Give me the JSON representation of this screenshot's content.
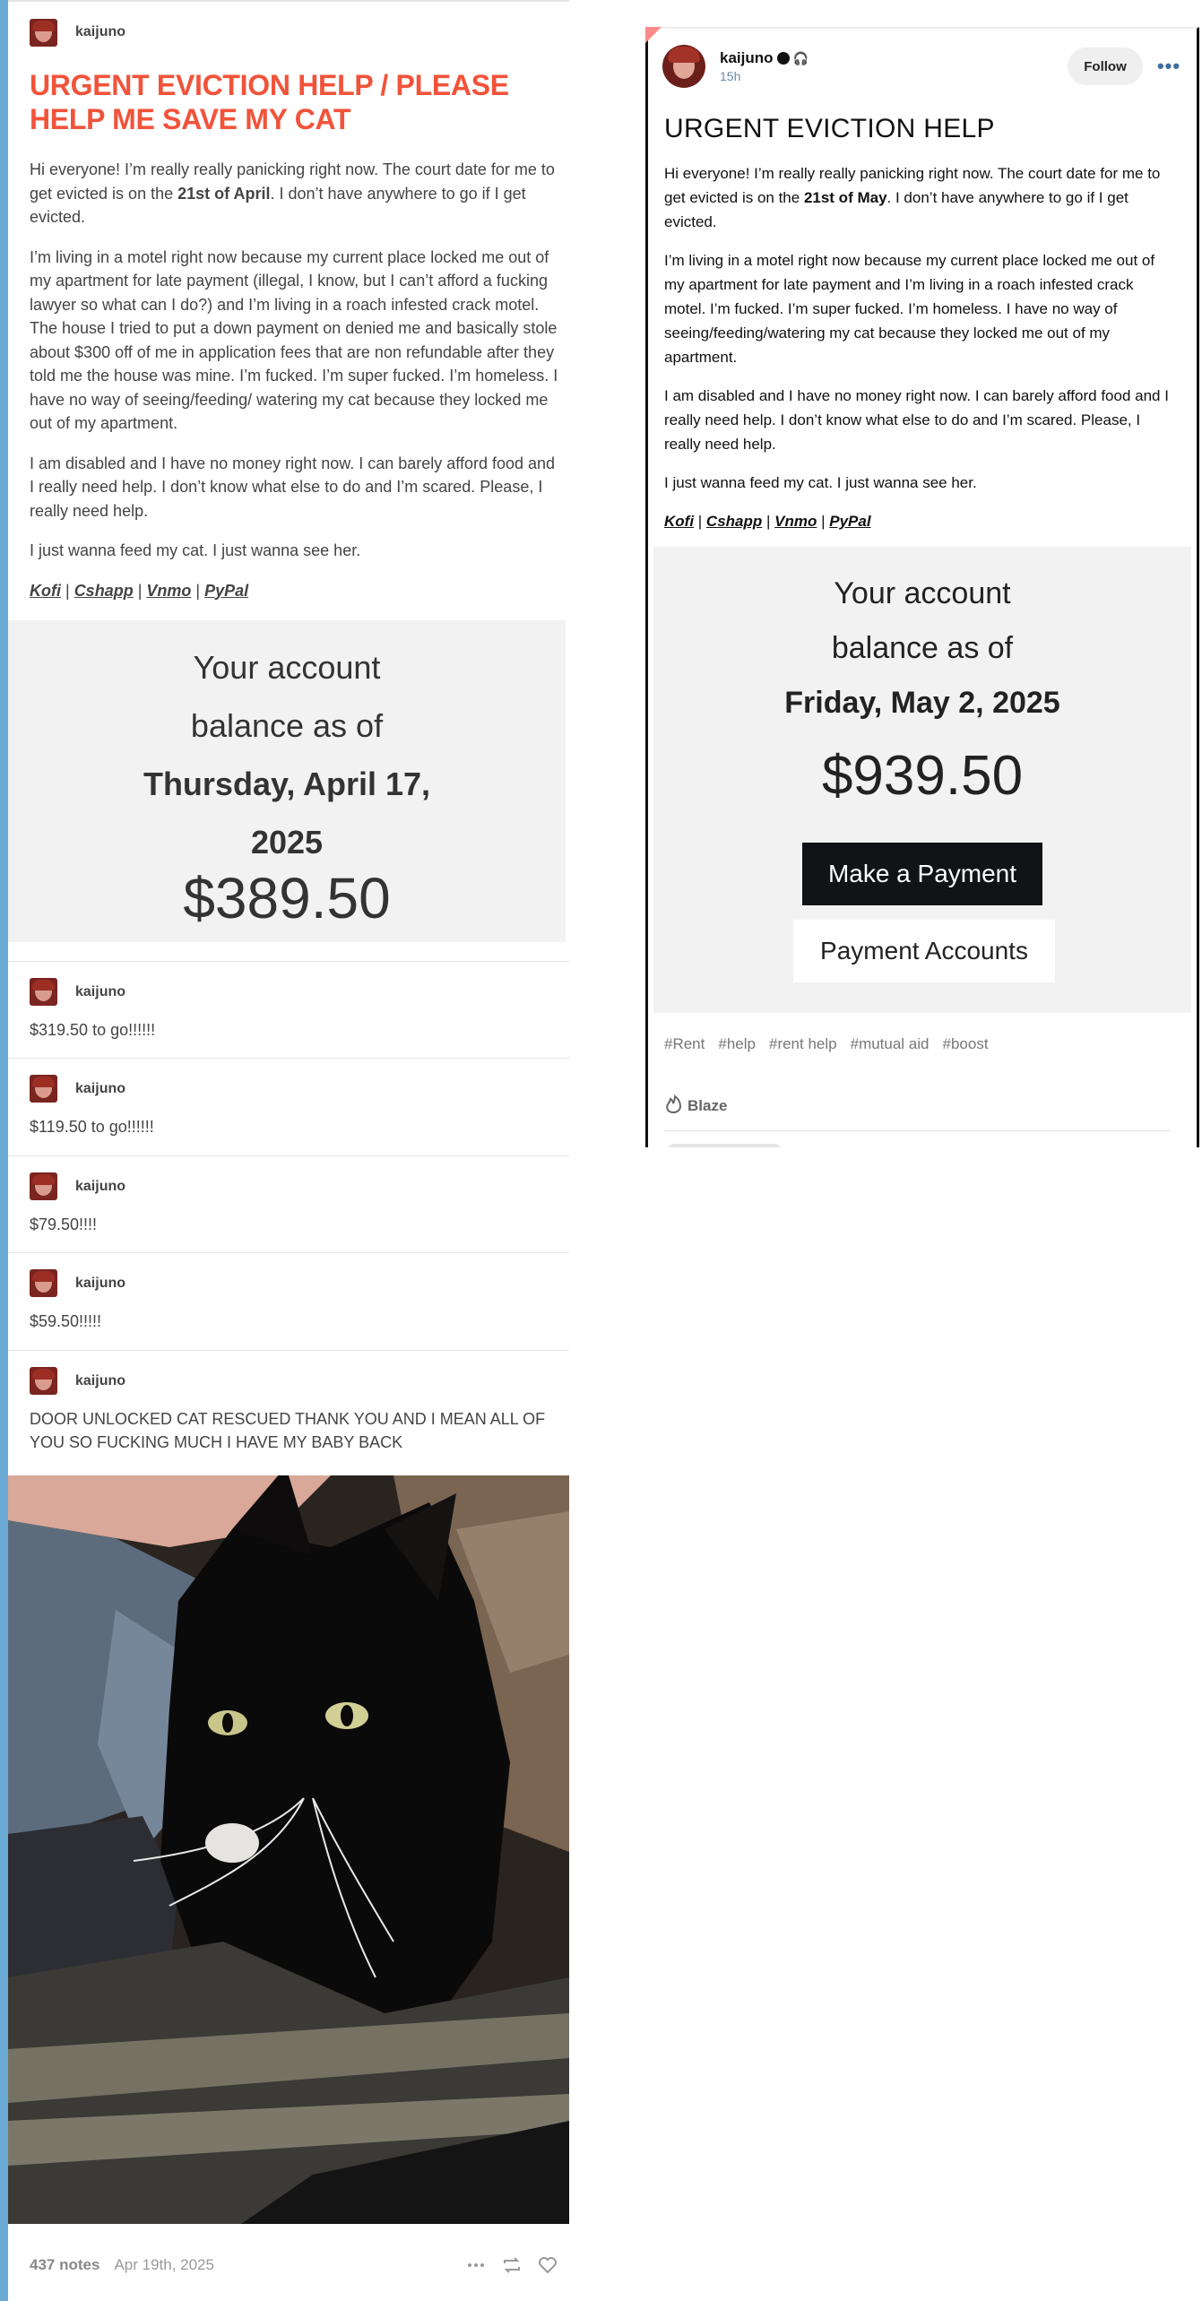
{
  "left_post": {
    "username": "kaijuno",
    "title": "URGENT EVICTION HELP / PLEASE HELP ME SAVE MY CAT",
    "p1_pre": "Hi everyone! I’m really really panicking right now. The court date for me to get evicted is on the ",
    "p1_bold": "21st of April",
    "p1_post": ". I don’t have anywhere to go if I get evicted.",
    "p2": "I’m living in a motel right now because my current place locked me out of my apartment for late payment (illegal, I know, but I can’t afford a fucking lawyer so what can I do?) and I’m living in a roach infested crack motel. The house I tried to put a down payment on denied me and basically stole about $300 off of me in application fees that are non refundable after they told me the house was mine. I’m fucked. I’m super fucked. I’m homeless. I have no way of seeing/feeding/ watering my cat because they locked me out of my apartment.",
    "p3": "I am disabled and I have no money right now. I can barely afford food and I really need help. I don’t know what else to do and I’m scared. Please, I really need help.",
    "p4": "I just wanna feed my cat. I just wanna see her.",
    "links": [
      "Kofi",
      "Cshapp",
      "Vnmo",
      "PyPal"
    ],
    "link_separator": " | ",
    "balance": {
      "line1": "Your account",
      "line2": "balance as of",
      "date_line1": "Thursday, April 17,",
      "date_line2": "2025",
      "amount": "$389.50"
    },
    "reblogs": [
      {
        "username": "kaijuno",
        "text": "$319.50 to go!!!!!!"
      },
      {
        "username": "kaijuno",
        "text": "$119.50 to go!!!!!!"
      },
      {
        "username": "kaijuno",
        "text": "$79.50!!!!"
      },
      {
        "username": "kaijuno",
        "text": "$59.50!!!!!"
      },
      {
        "username": "kaijuno",
        "text": "DOOR UNLOCKED CAT RESCUED THANK YOU AND I MEAN ALL OF YOU SO FUCKING MUCH I HAVE MY BABY BACK"
      }
    ],
    "footer": {
      "notes": "437 notes",
      "date": "Apr 19th, 2025",
      "icons": [
        "more-icon",
        "reblog-icon",
        "like-heart-icon"
      ]
    }
  },
  "right_post": {
    "username": "kaijuno",
    "badges": [
      "black-dot-badge",
      "headphones-badge"
    ],
    "time": "15h",
    "follow_label": "Follow",
    "more_label": "•••",
    "title": "URGENT EVICTION HELP",
    "p1_pre": "Hi everyone! I’m really really panicking right now. The court date for me to get evicted is on the ",
    "p1_bold": "21st of May",
    "p1_post": ". I don’t have anywhere to go if I get evicted.",
    "p2": "I’m living in a motel right now because my current place locked me out of my apartment for late payment and I’m living in a roach infested crack motel. I’m fucked. I’m super fucked. I’m homeless. I have no way of seeing/feeding/watering my cat because they locked me out of my apartment.",
    "p3": "I am disabled and I have no money right now. I can barely afford food and I really need help. I don’t know what else to do and I’m scared. Please, I really need help.",
    "p4": "I just wanna feed my cat. I just wanna see her.",
    "links": [
      "Kofi",
      "Cshapp",
      "Vnmo",
      "PyPal"
    ],
    "balance": {
      "line1": "Your account",
      "line2": "balance as of",
      "date": "Friday, May 2, 2025",
      "amount": "$939.50",
      "pay_button": "Make a Payment",
      "accounts_button": "Payment Accounts"
    },
    "tags": [
      "#Rent",
      "#help",
      "#rent help",
      "#mutual aid",
      "#boost"
    ],
    "blaze_label": "Blaze"
  },
  "colors": {
    "left_accent_bar": "#6aaad4",
    "title_red": "#f1533a",
    "balance_bg": "#f2f2f2",
    "pay_button_bg": "#111316",
    "corner_flag": "#ff8a8a"
  }
}
